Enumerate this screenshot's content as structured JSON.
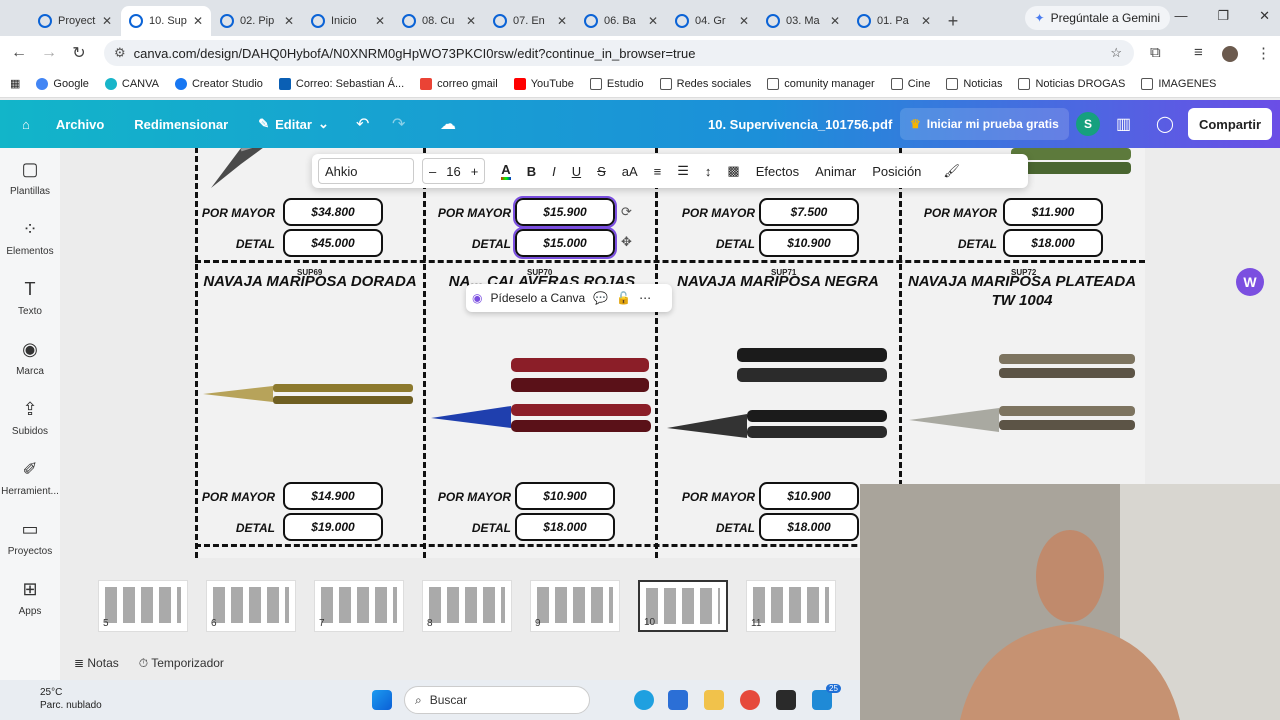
{
  "browser": {
    "tabs": [
      {
        "label": "Proyect",
        "active": false
      },
      {
        "label": "10. Sup",
        "active": true
      },
      {
        "label": "02. Pip",
        "active": false
      },
      {
        "label": "Inicio",
        "active": false
      },
      {
        "label": "08. Cu",
        "active": false
      },
      {
        "label": "07. En",
        "active": false
      },
      {
        "label": "06. Ba",
        "active": false
      },
      {
        "label": "04. Gr",
        "active": false
      },
      {
        "label": "03. Ma",
        "active": false
      },
      {
        "label": "01. Pa",
        "active": false
      }
    ],
    "gemini_label": "Pregúntale a Gemini",
    "url": "canva.com/design/DAHQ0HybofA/N0XNRM0gHpWO73PKCI0rsw/edit?continue_in_browser=true",
    "bookmarks": [
      "Google",
      "CANVA",
      "Creator Studio",
      "Correo: Sebastian Á...",
      "correo gmail",
      "YouTube",
      "Estudio",
      "Redes sociales",
      "comunity manager",
      "Cine",
      "Noticias",
      "Noticias DROGAS",
      "IMAGENES"
    ]
  },
  "canva": {
    "menu": {
      "archivo": "Archivo",
      "redimensionar": "Redimensionar",
      "editar": "Editar"
    },
    "doc_title": "10. Supervivencia_101756.pdf",
    "trial": "Iniciar mi prueba gratis",
    "avatar_letter": "S",
    "share": "Compartir",
    "sidebar": [
      "Plantillas",
      "Elementos",
      "Texto",
      "Marca",
      "Subidos",
      "Herramient...",
      "Proyectos",
      "Apps"
    ],
    "toolbar": {
      "font": "Ahkio",
      "size": "16",
      "minus": "–",
      "plus": "+",
      "efectos": "Efectos",
      "animar": "Animar",
      "posicion": "Posición"
    },
    "ask_canva": "Pídeselo a Canva",
    "bottom": {
      "notas": "Notas",
      "temporizador": "Temporizador"
    },
    "thumbnails": [
      "5",
      "6",
      "7",
      "8",
      "9",
      "10",
      "11"
    ],
    "active_thumb": "10"
  },
  "catalog": {
    "por_mayor": "POR MAYOR",
    "detal": "DETAL",
    "top_row": [
      {
        "mayor": "$34.800",
        "detal": "$45.000"
      },
      {
        "mayor": "$15.900",
        "detal": "$15.000"
      },
      {
        "mayor": "$7.500",
        "detal": "$10.900"
      },
      {
        "mayor": "$11.900",
        "detal": "$18.000"
      }
    ],
    "bottom_row": [
      {
        "code": "SUP69",
        "title": "NAVAJA MARIPOSA DORADA",
        "mayor": "$14.900",
        "detal": "$19.000"
      },
      {
        "code": "SUP70",
        "title": "NA... CALAVERAS ROJAS",
        "mayor": "$10.900",
        "detal": "$18.000"
      },
      {
        "code": "SUP71",
        "title": "NAVAJA MARIPOSA NEGRA",
        "mayor": "$10.900",
        "detal": "$18.000"
      },
      {
        "code": "SUP72",
        "title": "NAVAJA MARIPOSA PLATEADA TW 1004",
        "mayor": "",
        "detal": ""
      }
    ]
  },
  "taskbar": {
    "temp": "25°C",
    "weather": "Parc. nublado",
    "search": "Buscar",
    "badge": "25"
  }
}
